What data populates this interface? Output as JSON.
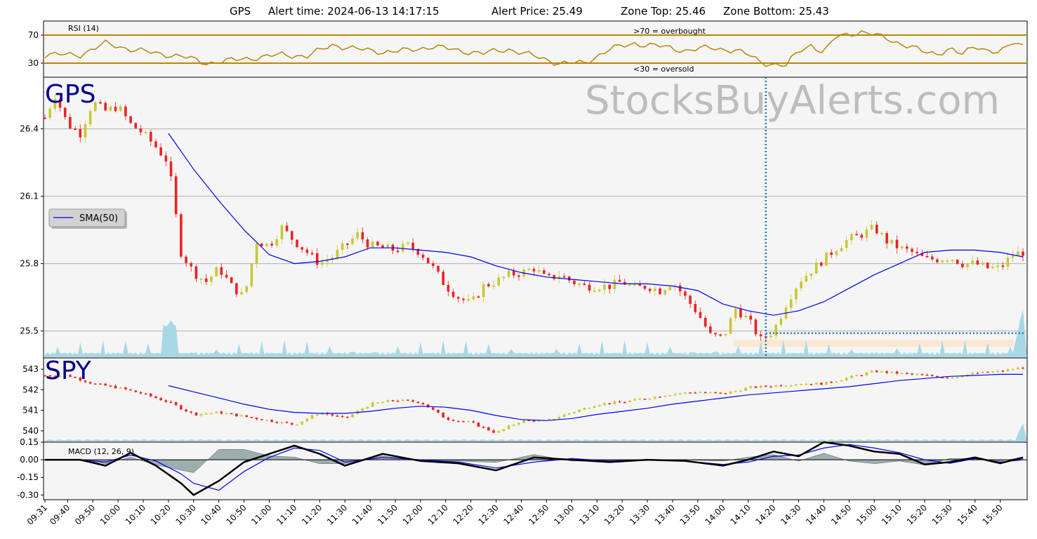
{
  "header": {
    "ticker": "GPS",
    "alert_time_label": "Alert time: 2024-06-13 14:17:15",
    "alert_price_label": "Alert Price: 25.49",
    "zone_top_label": "Zone Top: 25.46",
    "zone_bottom_label": "Zone Bottom: 25.43"
  },
  "watermark": "StocksBuyAlerts.com",
  "colors": {
    "up_candle": "#c8c832",
    "down_candle": "#ee2222",
    "sma": "#0000ee",
    "rsi": "#b8860b",
    "volume": "#a8d8e6",
    "zone": "#fbe7d0",
    "alert_line": "#1f77b4",
    "macd": "#000000",
    "macd_signal": "#0000ee",
    "macd_hist": "#7f9595",
    "panel_bg": "#f5f5f5",
    "ticker_label": "#00008b",
    "watermark": "#bdbdbd"
  },
  "chart_data": [
    {
      "type": "line",
      "name": "rsi",
      "label": "RSI (14)",
      "ylim": [
        10,
        90
      ],
      "yticks": [
        "70",
        "30"
      ],
      "ytick_values": [
        70,
        30
      ],
      "overbought_level": 70,
      "oversold_level": 30,
      "overbought_label": ">70 = overbought",
      "oversold_label": "<30 = oversold",
      "x": [
        "09:31",
        "09:45",
        "09:55",
        "10:05",
        "10:15",
        "10:25",
        "10:35",
        "10:45",
        "10:55",
        "11:05",
        "11:15",
        "11:25",
        "11:35",
        "11:45",
        "11:55",
        "12:05",
        "12:15",
        "12:25",
        "12:35",
        "12:45",
        "12:55",
        "13:05",
        "13:15",
        "13:25",
        "13:35",
        "13:45",
        "13:55",
        "14:00",
        "14:05",
        "14:10",
        "14:15",
        "14:20",
        "14:25",
        "14:30",
        "14:35",
        "14:40",
        "14:45",
        "14:50",
        "14:55",
        "15:00",
        "15:05",
        "15:10",
        "15:15",
        "15:20",
        "15:25",
        "15:30",
        "15:35",
        "15:40",
        "15:45",
        "15:50",
        "15:55",
        "15:59"
      ],
      "values": [
        42,
        42,
        58,
        50,
        44,
        40,
        30,
        34,
        38,
        42,
        40,
        56,
        50,
        46,
        48,
        54,
        48,
        44,
        50,
        40,
        30,
        30,
        50,
        58,
        54,
        48,
        52,
        50,
        48,
        42,
        32,
        28,
        26,
        48,
        56,
        44,
        68,
        72,
        74,
        70,
        66,
        58,
        52,
        46,
        44,
        50,
        42,
        56,
        48,
        44,
        60,
        56
      ]
    },
    {
      "type": "line",
      "name": "gps-price",
      "ticker_label": "GPS",
      "legend_label": "SMA(50)",
      "ylim": [
        25.38,
        26.63
      ],
      "yticks": [
        "26.4",
        "26.1",
        "25.8",
        "25.5"
      ],
      "ytick_values": [
        26.4,
        26.1,
        25.8,
        25.5
      ],
      "grid": true,
      "alert_time": "14:17",
      "alert_price": 25.49,
      "zone_top": 25.46,
      "zone_bottom": 25.43,
      "x": [
        "09:31",
        "09:35",
        "09:40",
        "09:45",
        "09:50",
        "09:55",
        "10:00",
        "10:05",
        "10:10",
        "10:15",
        "10:20",
        "10:25",
        "10:30",
        "10:35",
        "10:40",
        "10:45",
        "10:50",
        "10:55",
        "11:00",
        "11:05",
        "11:10",
        "11:15",
        "11:20",
        "11:25",
        "11:30",
        "11:35",
        "11:40",
        "11:45",
        "11:50",
        "11:55",
        "12:00",
        "12:05",
        "12:10",
        "12:15",
        "12:20",
        "12:25",
        "12:30",
        "12:35",
        "12:40",
        "12:45",
        "12:50",
        "12:55",
        "13:00",
        "13:05",
        "13:10",
        "13:15",
        "13:20",
        "13:25",
        "13:30",
        "13:35",
        "13:40",
        "13:45",
        "13:50",
        "13:55",
        "14:00",
        "14:05",
        "14:10",
        "14:15",
        "14:20",
        "14:25",
        "14:30",
        "14:35",
        "14:40",
        "14:45",
        "14:50",
        "14:55",
        "15:00",
        "15:05",
        "15:10",
        "15:15",
        "15:20",
        "15:25",
        "15:30",
        "15:35",
        "15:40",
        "15:45",
        "15:50",
        "15:55",
        "15:59"
      ],
      "values": [
        26.45,
        26.55,
        26.42,
        26.38,
        26.52,
        26.48,
        26.5,
        26.42,
        26.38,
        26.32,
        26.25,
        25.85,
        25.76,
        25.72,
        25.78,
        25.7,
        25.65,
        25.9,
        25.88,
        25.96,
        25.9,
        25.85,
        25.8,
        25.83,
        25.88,
        25.93,
        25.88,
        25.87,
        25.86,
        25.88,
        25.85,
        25.78,
        25.7,
        25.65,
        25.62,
        25.7,
        25.72,
        25.75,
        25.76,
        25.78,
        25.73,
        25.75,
        25.72,
        25.7,
        25.7,
        25.7,
        25.72,
        25.69,
        25.7,
        25.68,
        25.72,
        25.65,
        25.58,
        25.48,
        25.47,
        25.6,
        25.55,
        25.46,
        25.5,
        25.62,
        25.72,
        25.77,
        25.82,
        25.87,
        25.91,
        25.93,
        25.96,
        25.9,
        25.87,
        25.85,
        25.82,
        25.82,
        25.83,
        25.8,
        25.8,
        25.78,
        25.78,
        25.84,
        25.85
      ],
      "sma_x": [
        "10:20",
        "10:30",
        "10:40",
        "10:50",
        "11:00",
        "11:10",
        "11:20",
        "11:30",
        "11:40",
        "11:50",
        "12:00",
        "12:10",
        "12:20",
        "12:30",
        "12:40",
        "12:50",
        "13:00",
        "13:10",
        "13:20",
        "13:30",
        "13:40",
        "13:50",
        "14:00",
        "14:10",
        "14:20",
        "14:30",
        "14:40",
        "14:50",
        "15:00",
        "15:10",
        "15:20",
        "15:30",
        "15:40",
        "15:50",
        "15:59"
      ],
      "sma_values": [
        26.38,
        26.22,
        26.08,
        25.95,
        25.84,
        25.8,
        25.81,
        25.83,
        25.87,
        25.87,
        25.86,
        25.85,
        25.83,
        25.79,
        25.76,
        25.74,
        25.73,
        25.72,
        25.71,
        25.71,
        25.7,
        25.68,
        25.62,
        25.59,
        25.57,
        25.59,
        25.63,
        25.69,
        25.75,
        25.8,
        25.85,
        25.86,
        25.86,
        25.85,
        25.83
      ]
    },
    {
      "type": "line",
      "name": "spy-price",
      "ticker_label": "SPY",
      "ylim": [
        539.45,
        543.55
      ],
      "yticks": [
        "543",
        "542",
        "541",
        "540"
      ],
      "ytick_values": [
        543,
        542,
        541,
        540
      ],
      "x": [
        "09:31",
        "09:40",
        "09:50",
        "10:00",
        "10:10",
        "10:20",
        "10:30",
        "10:40",
        "10:50",
        "11:00",
        "11:10",
        "11:20",
        "11:30",
        "11:40",
        "11:50",
        "12:00",
        "12:10",
        "12:20",
        "12:30",
        "12:40",
        "12:50",
        "13:00",
        "13:10",
        "13:20",
        "13:30",
        "13:40",
        "13:50",
        "14:00",
        "14:10",
        "14:20",
        "14:30",
        "14:40",
        "14:50",
        "15:00",
        "15:10",
        "15:20",
        "15:30",
        "15:40",
        "15:50",
        "15:59"
      ],
      "values": [
        542.7,
        542.7,
        542.3,
        542.1,
        541.8,
        541.4,
        540.8,
        540.9,
        540.7,
        540.5,
        540.3,
        540.9,
        540.6,
        541.3,
        541.5,
        541.4,
        540.6,
        540.4,
        539.9,
        540.5,
        540.5,
        540.9,
        541.3,
        541.4,
        541.6,
        541.8,
        541.9,
        541.8,
        542.1,
        542.2,
        542.3,
        542.3,
        542.6,
        542.9,
        542.8,
        542.7,
        542.6,
        542.8,
        542.9,
        543.1
      ],
      "sma_x": [
        "10:20",
        "10:30",
        "10:40",
        "10:50",
        "11:00",
        "11:10",
        "11:20",
        "11:30",
        "11:40",
        "11:50",
        "12:00",
        "12:10",
        "12:20",
        "12:30",
        "12:40",
        "12:50",
        "13:00",
        "13:10",
        "13:20",
        "13:30",
        "13:40",
        "13:50",
        "14:00",
        "14:10",
        "14:20",
        "14:30",
        "14:40",
        "14:50",
        "15:00",
        "15:10",
        "15:20",
        "15:30",
        "15:40",
        "15:50",
        "15:59"
      ],
      "sma_values": [
        542.2,
        541.9,
        541.6,
        541.3,
        541.05,
        540.9,
        540.85,
        540.85,
        540.95,
        541.1,
        541.2,
        541.15,
        541.0,
        540.75,
        540.55,
        540.5,
        540.6,
        540.8,
        540.95,
        541.1,
        541.3,
        541.45,
        541.6,
        541.75,
        541.85,
        541.95,
        542.05,
        542.15,
        542.3,
        542.45,
        542.55,
        542.65,
        542.7,
        542.75,
        542.75
      ]
    },
    {
      "type": "line",
      "name": "macd",
      "label": "MACD (12, 26, 9)",
      "ylim": [
        -0.34,
        0.15
      ],
      "yticks": [
        "0.15",
        "0.00",
        "-0.15",
        "-0.30"
      ],
      "ytick_values": [
        0.15,
        0.0,
        -0.15,
        -0.3
      ],
      "x": [
        "09:31",
        "09:45",
        "09:55",
        "10:05",
        "10:15",
        "10:25",
        "10:30",
        "10:40",
        "10:50",
        "11:00",
        "11:10",
        "11:20",
        "11:30",
        "11:45",
        "12:00",
        "12:15",
        "12:30",
        "12:45",
        "13:00",
        "13:15",
        "13:30",
        "13:45",
        "14:00",
        "14:10",
        "14:20",
        "14:30",
        "14:40",
        "14:50",
        "15:00",
        "15:10",
        "15:20",
        "15:30",
        "15:40",
        "15:50",
        "15:59"
      ],
      "series": [
        {
          "name": "macd",
          "values": [
            0,
            0,
            -0.05,
            0.06,
            -0.05,
            -0.2,
            -0.3,
            -0.18,
            -0.02,
            0.05,
            0.12,
            0.05,
            -0.05,
            0.05,
            -0.01,
            -0.03,
            -0.09,
            0.02,
            0.0,
            -0.02,
            0.0,
            -0.01,
            -0.05,
            0.0,
            0.07,
            0.03,
            0.15,
            0.12,
            0.07,
            0.05,
            -0.04,
            -0.02,
            0.02,
            -0.03,
            0.02
          ]
        },
        {
          "name": "signal",
          "values": [
            0,
            0,
            -0.02,
            0.04,
            -0.01,
            -0.12,
            -0.2,
            -0.26,
            -0.1,
            0.02,
            0.1,
            0.08,
            -0.02,
            0.02,
            0.0,
            -0.02,
            -0.07,
            -0.02,
            0.01,
            -0.01,
            0.0,
            -0.01,
            -0.04,
            -0.02,
            0.03,
            0.04,
            0.1,
            0.13,
            0.1,
            0.06,
            0.0,
            -0.03,
            0.01,
            -0.02,
            0.0
          ]
        }
      ]
    }
  ],
  "x_ticks": [
    "09:31",
    "09:40",
    "09:50",
    "10:00",
    "10:10",
    "10:20",
    "10:30",
    "10:40",
    "10:50",
    "11:00",
    "11:10",
    "11:20",
    "11:30",
    "11:40",
    "11:50",
    "12:00",
    "12:10",
    "12:20",
    "12:30",
    "12:40",
    "12:50",
    "13:00",
    "13:10",
    "13:20",
    "13:30",
    "13:40",
    "13:50",
    "14:00",
    "14:10",
    "14:20",
    "14:30",
    "14:40",
    "14:50",
    "15:00",
    "15:10",
    "15:20",
    "15:30",
    "15:40",
    "15:50"
  ]
}
